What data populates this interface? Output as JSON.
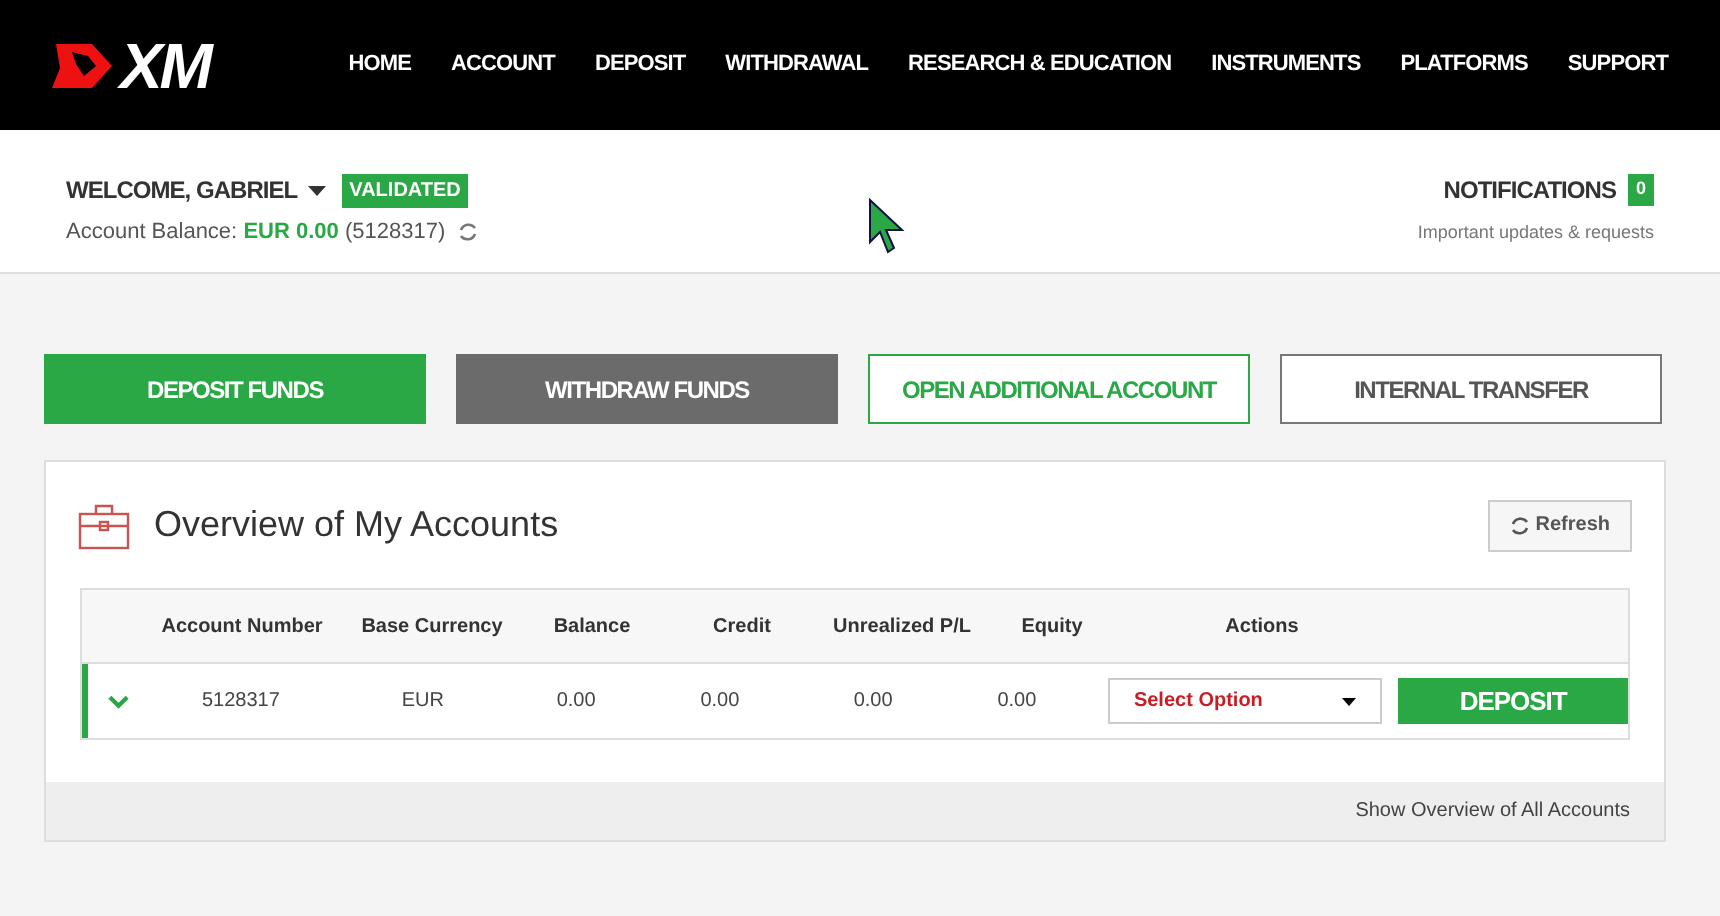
{
  "nav": {
    "logo": "XM",
    "items": [
      "HOME",
      "ACCOUNT",
      "DEPOSIT",
      "WITHDRAWAL",
      "RESEARCH & EDUCATION",
      "INSTRUMENTS",
      "PLATFORMS",
      "SUPPORT"
    ]
  },
  "user": {
    "welcome": "WELCOME, GABRIEL",
    "badge": "VALIDATED",
    "balance_label": "Account Balance:",
    "balance": "EUR 0.00",
    "account": "(5128317)"
  },
  "notifications": {
    "title": "NOTIFICATIONS",
    "count": "0",
    "subtitle": "Important updates & requests"
  },
  "actions": [
    {
      "label": "DEPOSIT FUNDS",
      "kind": "primary"
    },
    {
      "label": "WITHDRAW FUNDS",
      "kind": "dark"
    },
    {
      "label": "OPEN ADDITIONAL ACCOUNT",
      "kind": "outline-green"
    },
    {
      "label": "INTERNAL TRANSFER",
      "kind": "outline-gray"
    }
  ],
  "overview": {
    "title": "Overview of My Accounts",
    "refresh": "Refresh",
    "table": {
      "columns": [
        "Account Number",
        "Base Currency",
        "Balance",
        "Credit",
        "Unrealized P/L",
        "Equity",
        "Actions"
      ],
      "rows": [
        {
          "cells": [
            "5128317",
            "EUR",
            "0.00",
            "0.00",
            "0.00",
            "0.00"
          ],
          "select": "Select Option",
          "button": "DEPOSIT"
        }
      ]
    },
    "footer_link": "Show Overview of All Accounts"
  }
}
